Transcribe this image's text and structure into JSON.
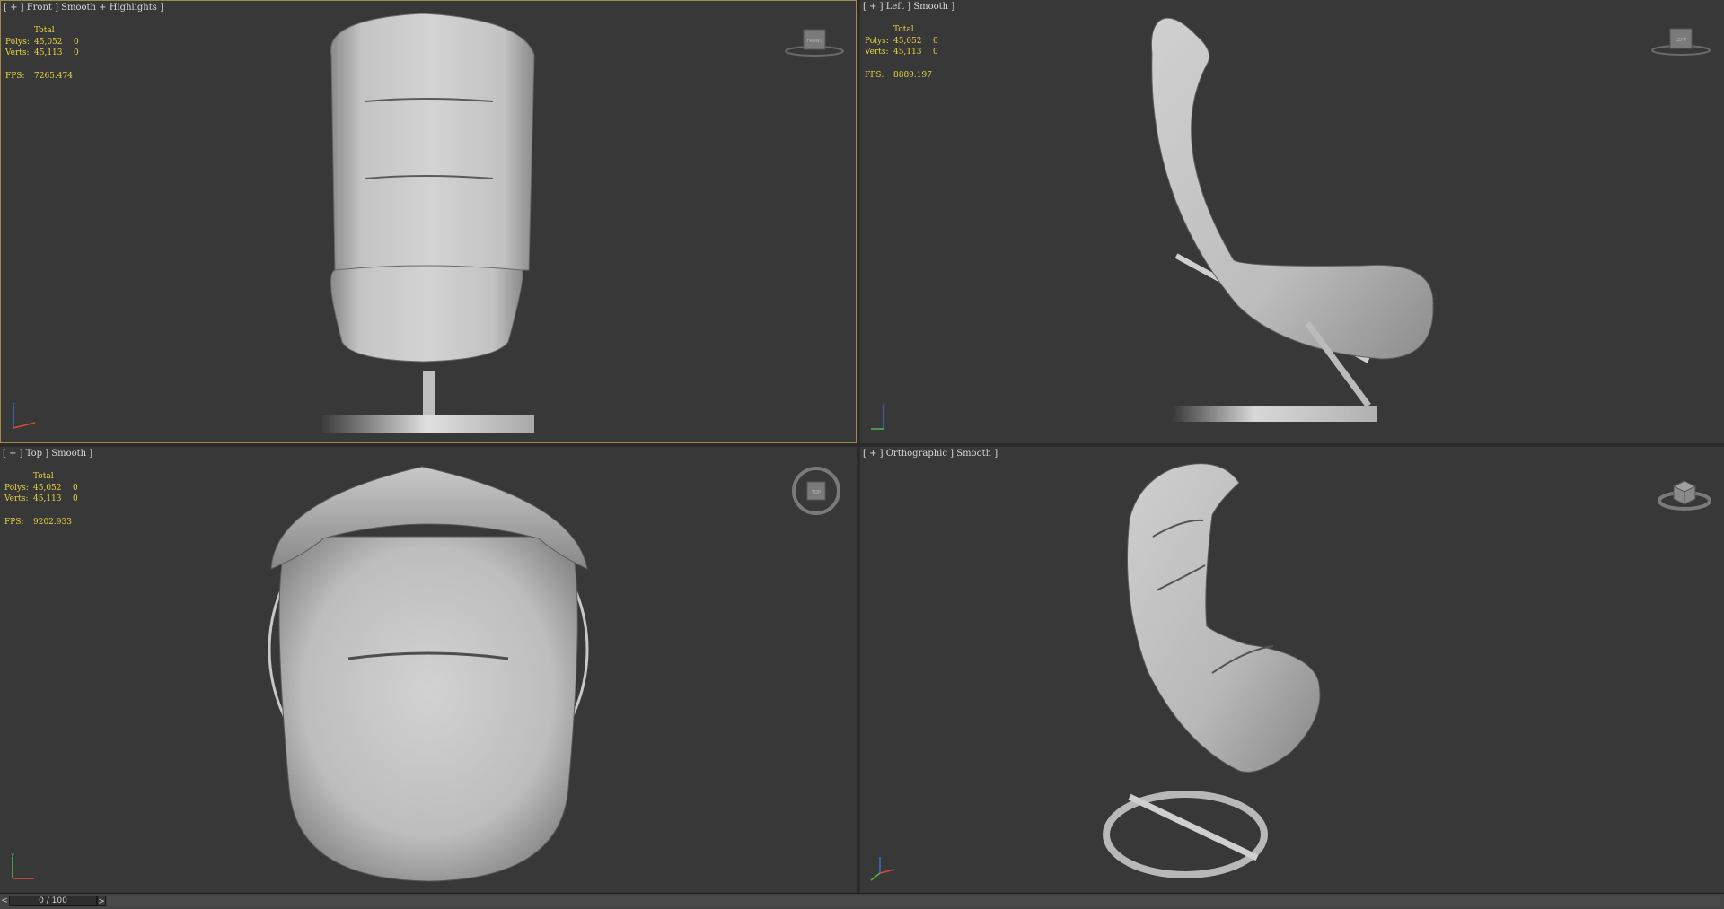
{
  "viewports": {
    "front": {
      "label": "[ + ] Front ] Smooth + Highlights ]",
      "stats": {
        "header": "Total",
        "polys_label": "Polys:",
        "polys_total": "45,052",
        "polys_sel": "0",
        "verts_label": "Verts:",
        "verts_total": "45,113",
        "verts_sel": "0",
        "fps_label": "FPS:",
        "fps": "7265.474"
      },
      "viewcube_text": "FRONT"
    },
    "left": {
      "label": "[ + ] Left ] Smooth ]",
      "stats": {
        "header": "Total",
        "polys_label": "Polys:",
        "polys_total": "45,052",
        "polys_sel": "0",
        "verts_label": "Verts:",
        "verts_total": "45,113",
        "verts_sel": "0",
        "fps_label": "FPS:",
        "fps": "8889.197"
      },
      "viewcube_text": "LEFT"
    },
    "top": {
      "label": "[ + ] Top ] Smooth ]",
      "stats": {
        "header": "Total",
        "polys_label": "Polys:",
        "polys_total": "45,052",
        "polys_sel": "0",
        "verts_label": "Verts:",
        "verts_total": "45,113",
        "verts_sel": "0",
        "fps_label": "FPS:",
        "fps": "9202.933"
      },
      "viewcube_text": "TOP"
    },
    "perspective": {
      "label": "[ + ] Orthographic ] Smooth ]"
    }
  },
  "timeline": {
    "frame_display": "0 / 100",
    "prev_label": "<",
    "next_label": ">"
  },
  "colors": {
    "viewport_bg": "#383838",
    "stats_text": "#e6d640",
    "active_border": "#a08a4a"
  }
}
